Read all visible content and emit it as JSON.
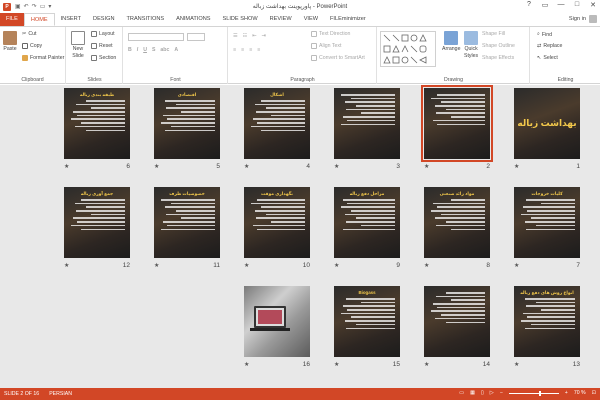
{
  "titlebar": {
    "title": "پاورپوینت بهداشت زباله - PowerPoint",
    "qat": [
      "save",
      "undo",
      "redo"
    ],
    "controls": [
      "?",
      "▭",
      "—",
      "□",
      "✕"
    ]
  },
  "tabs": [
    "FILE",
    "HOME",
    "INSERT",
    "DESIGN",
    "TRANSITIONS",
    "ANIMATIONS",
    "SLIDE SHOW",
    "REVIEW",
    "VIEW",
    "FILEminimizer"
  ],
  "active_tab": "HOME",
  "signin": "Sign in",
  "ribbon": {
    "clipboard": {
      "label": "Clipboard",
      "paste": "Paste",
      "cut": "Cut",
      "copy": "Copy",
      "format_painter": "Format Painter"
    },
    "slides": {
      "label": "Slides",
      "new_slide": "New",
      "new_slide_2": "Slide",
      "layout": "Layout",
      "reset": "Reset",
      "section": "Section"
    },
    "font": {
      "label": "Font"
    },
    "paragraph": {
      "label": "Paragraph",
      "text_direction": "Text Direction",
      "align_text": "Align Text",
      "convert": "Convert to SmartArt"
    },
    "drawing": {
      "label": "Drawing",
      "arrange": "Arrange",
      "quick_styles": "Quick",
      "quick_styles_2": "Styles",
      "shape_fill": "Shape Fill",
      "shape_outline": "Shape Outline",
      "shape_effects": "Shape Effects"
    },
    "editing": {
      "label": "Editing",
      "find": "Find",
      "replace": "Replace",
      "select": "Select"
    }
  },
  "slides": [
    {
      "num": "1",
      "title": "بهداشت زباله",
      "kind": "title",
      "selected": false
    },
    {
      "num": "2",
      "title": "",
      "kind": "text",
      "selected": true
    },
    {
      "num": "3",
      "title": "",
      "kind": "text",
      "selected": false
    },
    {
      "num": "4",
      "title": "اشکال",
      "kind": "text",
      "selected": false
    },
    {
      "num": "5",
      "title": "اقتصادی",
      "kind": "text",
      "selected": false
    },
    {
      "num": "6",
      "title": "طبقه بندی زباله",
      "kind": "text",
      "selected": false
    },
    {
      "num": "7",
      "title": "کلیات خروجات",
      "kind": "text",
      "selected": false
    },
    {
      "num": "8",
      "title": "مواد زائد صنعتی",
      "kind": "text",
      "selected": false
    },
    {
      "num": "9",
      "title": "مراحل دفع زباله",
      "kind": "text",
      "selected": false
    },
    {
      "num": "10",
      "title": "نگهداری موقت",
      "kind": "text",
      "selected": false
    },
    {
      "num": "11",
      "title": "خصوصیات ظرف",
      "kind": "text",
      "selected": false
    },
    {
      "num": "12",
      "title": "جمع آوری زباله",
      "kind": "text",
      "selected": false
    },
    {
      "num": "13",
      "title": "انواع روش های دفع زباله",
      "kind": "text",
      "selected": false
    },
    {
      "num": "14",
      "title": "",
      "kind": "text",
      "selected": false
    },
    {
      "num": "15",
      "title": "Biogass",
      "kind": "text",
      "selected": false
    },
    {
      "num": "16",
      "title": "",
      "kind": "photo",
      "selected": false
    }
  ],
  "status": {
    "slide_of": "SLIDE 2 OF 16",
    "language": "PERSIAN",
    "zoom": "70 %"
  },
  "colors": {
    "accent": "#d24726",
    "slide_title": "#f2c84b",
    "workspace": "#e8e8e8"
  }
}
